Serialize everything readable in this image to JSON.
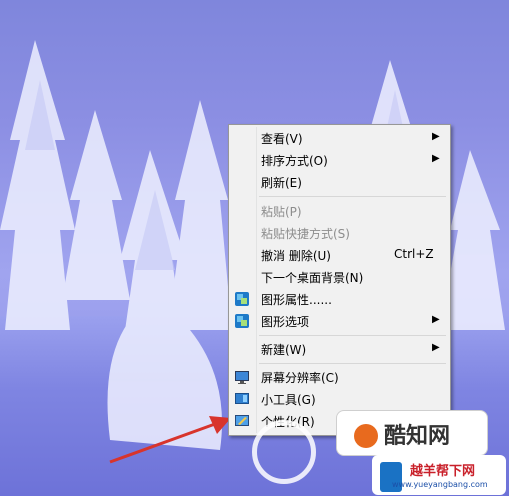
{
  "menu": {
    "items": [
      {
        "label": "查看(V)",
        "submenu": true,
        "disabled": false
      },
      {
        "label": "排序方式(O)",
        "submenu": true,
        "disabled": false
      },
      {
        "label": "刷新(E)",
        "submenu": false,
        "disabled": false
      },
      {
        "label": "粘贴(P)",
        "submenu": false,
        "disabled": true
      },
      {
        "label": "粘贴快捷方式(S)",
        "submenu": false,
        "disabled": true
      },
      {
        "label": "撤消 删除(U)",
        "shortcut": "Ctrl+Z",
        "submenu": false,
        "disabled": false
      },
      {
        "label": "下一个桌面背景(N)",
        "submenu": false,
        "disabled": false
      },
      {
        "label": "图形属性......",
        "icon": "intel-graphics-icon",
        "submenu": false,
        "disabled": false
      },
      {
        "label": "图形选项",
        "icon": "intel-graphics-icon",
        "submenu": true,
        "disabled": false
      },
      {
        "label": "新建(W)",
        "submenu": true,
        "disabled": false
      },
      {
        "label": "屏幕分辨率(C)",
        "icon": "monitor-icon",
        "submenu": false,
        "disabled": false
      },
      {
        "label": "小工具(G)",
        "icon": "gadgets-icon",
        "submenu": false,
        "disabled": false
      },
      {
        "label": "个性化(R)",
        "icon": "personalize-icon",
        "submenu": false,
        "disabled": false
      }
    ]
  },
  "watermark": {
    "brand": "酷知网",
    "site_name": "越羊帮下网",
    "url": "www.yueyangbang.com"
  },
  "colors": {
    "sky": "#8c8fe3",
    "menu_bg": "#f1f1f1",
    "arrow": "#d8342c"
  }
}
